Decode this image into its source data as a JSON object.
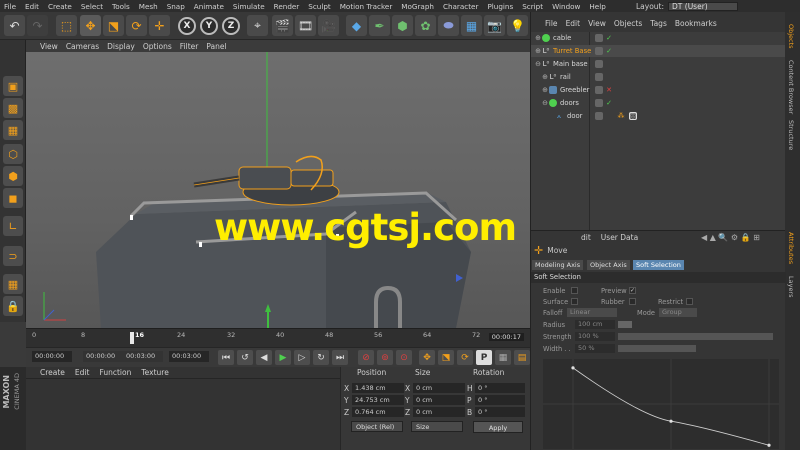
{
  "menubar": {
    "items": [
      "File",
      "Edit",
      "Create",
      "Select",
      "Tools",
      "Mesh",
      "Snap",
      "Animate",
      "Simulate",
      "Render",
      "Sculpt",
      "Motion Tracker",
      "MoGraph",
      "Character",
      "Plugins",
      "Script",
      "Window",
      "Help"
    ],
    "layout_label": "Layout:",
    "layout_value": "DT (User)"
  },
  "toolbar": {
    "axis_x": "X",
    "axis_y": "Y",
    "axis_z": "Z"
  },
  "viewport": {
    "menu": [
      "View",
      "Cameras",
      "Display",
      "Options",
      "Filter",
      "Panel"
    ]
  },
  "timeline": {
    "ticks": [
      "0",
      "8",
      "16",
      "24",
      "32",
      "40",
      "48",
      "56",
      "64",
      "72"
    ],
    "current_frame_display": "00:00:17",
    "current_tick": "16"
  },
  "playback": {
    "start_time": "00:00:00",
    "preview_start": "00:00:00",
    "preview_end": "00:03:00",
    "end_time": "00:03:00"
  },
  "material_manager": {
    "menu": [
      "Create",
      "Edit",
      "Function",
      "Texture"
    ]
  },
  "branding": {
    "maxon": "MAXON",
    "product": "CINEMA 4D"
  },
  "coordinates": {
    "headers": [
      "Position",
      "Size",
      "Rotation"
    ],
    "rows": [
      {
        "axis": "X",
        "position": "1.438 cm",
        "size_axis": "X",
        "size": "0 cm",
        "rot_axis": "H",
        "rotation": "0 °"
      },
      {
        "axis": "Y",
        "position": "24.753 cm",
        "size_axis": "Y",
        "size": "0 cm",
        "rot_axis": "P",
        "rotation": "0 °"
      },
      {
        "axis": "Z",
        "position": "0.764 cm",
        "size_axis": "Z",
        "size": "0 cm",
        "rot_axis": "B",
        "rotation": "0 °"
      }
    ],
    "mode_dropdown": "Object (Rel)",
    "size_dropdown": "Size",
    "apply_button": "Apply"
  },
  "object_manager": {
    "menu": [
      "File",
      "Edit",
      "View",
      "Objects",
      "Tags",
      "Bookmarks"
    ],
    "objects": [
      {
        "name": "cable",
        "highlighted": false,
        "indent": 0,
        "status": "check"
      },
      {
        "name": "Turret Base",
        "highlighted": true,
        "indent": 0,
        "status": "check"
      },
      {
        "name": "Main base",
        "highlighted": false,
        "indent": 0,
        "status": "none"
      },
      {
        "name": "rail",
        "highlighted": false,
        "indent": 1,
        "status": "none"
      },
      {
        "name": "Greebler",
        "highlighted": false,
        "indent": 1,
        "status": "cross"
      },
      {
        "name": "doors",
        "highlighted": false,
        "indent": 1,
        "status": "check"
      },
      {
        "name": "door",
        "highlighted": false,
        "indent": 2,
        "status": "tags"
      }
    ]
  },
  "right_tabs": [
    "Objects",
    "Content Browser",
    "Structure",
    "Attributes",
    "Layers"
  ],
  "attributes": {
    "menu": [
      "dit",
      "User Data"
    ],
    "tool_name": "Move",
    "tabs": [
      "Modeling Axis",
      "Object Axis",
      "Soft Selection"
    ],
    "active_tab": "Soft Selection",
    "section_title": "Soft Selection",
    "enable_label": "Enable",
    "preview_label": "Preview",
    "surface_label": "Surface",
    "rubber_label": "Rubber",
    "restrict_label": "Restrict",
    "falloff_label": "Falloff",
    "falloff_value": "Linear",
    "mode_label": "Mode",
    "mode_value": "Group",
    "radius_label": "Radius",
    "radius_value": "100 cm",
    "strength_label": "Strength",
    "strength_value": "100 %",
    "width_label": "Width . .",
    "width_value": "50 %",
    "graph_points": [
      [
        0,
        0.92
      ],
      [
        0.5,
        0.3
      ],
      [
        1.0,
        0.02
      ]
    ]
  },
  "watermark": "www.cgtsj.com",
  "colors": {
    "accent": "#f2a01c",
    "selected_tab": "#5a86b0",
    "watermark": "#ffee00"
  }
}
